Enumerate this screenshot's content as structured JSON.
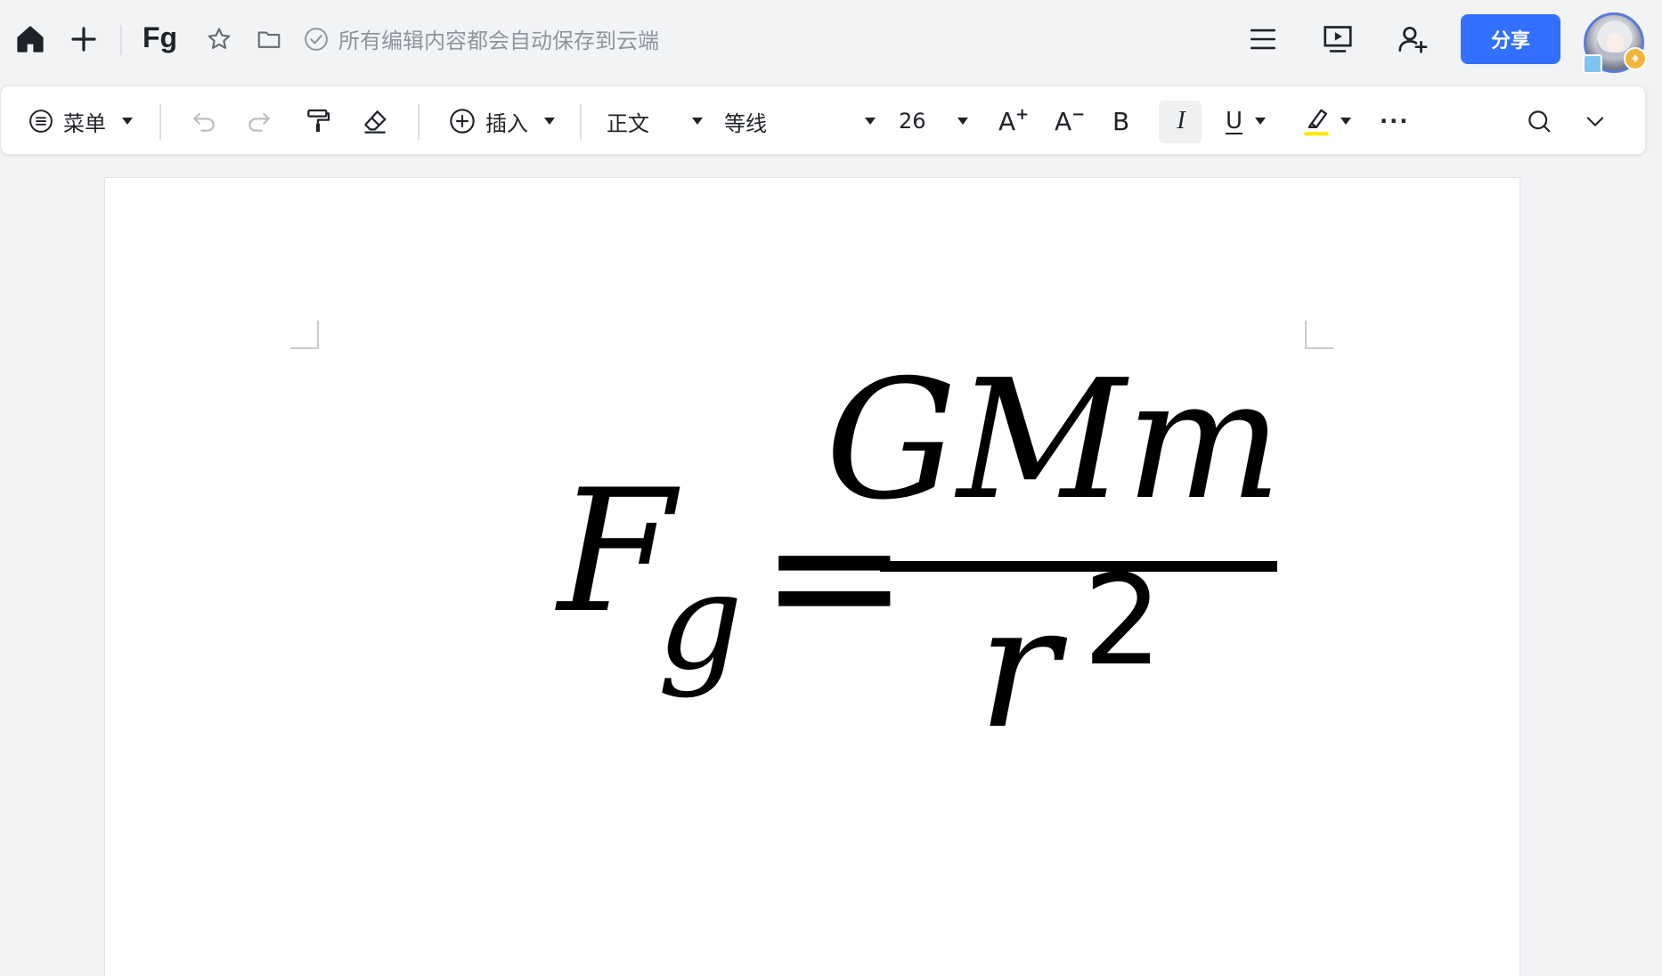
{
  "topbar": {
    "title": "Fg",
    "save_status": "所有编辑内容都会自动保存到云端",
    "share_label": "分享",
    "icons": [
      "home-icon",
      "plus-icon",
      "star-icon",
      "folder-icon",
      "check-circle-icon",
      "list-icon",
      "present-icon",
      "add-user-icon"
    ]
  },
  "toolbar": {
    "menu_label": "菜单",
    "insert_label": "插入",
    "style_value": "正文",
    "font_value": "等线",
    "size_value": "26",
    "bold_label": "B",
    "italic_label": "I",
    "underline_label": "U",
    "increase_label": "A",
    "decrease_label": "A",
    "more_label": "···",
    "highlight_color": "#ffe600"
  },
  "document": {
    "equation": {
      "lhs": "F",
      "lhs_sub": "g",
      "op": "=",
      "numerator": "GMm",
      "denominator": "r",
      "denominator_sup": "2"
    }
  },
  "colors": {
    "accent": "#3370ff",
    "background": "#f2f3f5",
    "text": "#1f2329",
    "muted": "#8f959e"
  }
}
